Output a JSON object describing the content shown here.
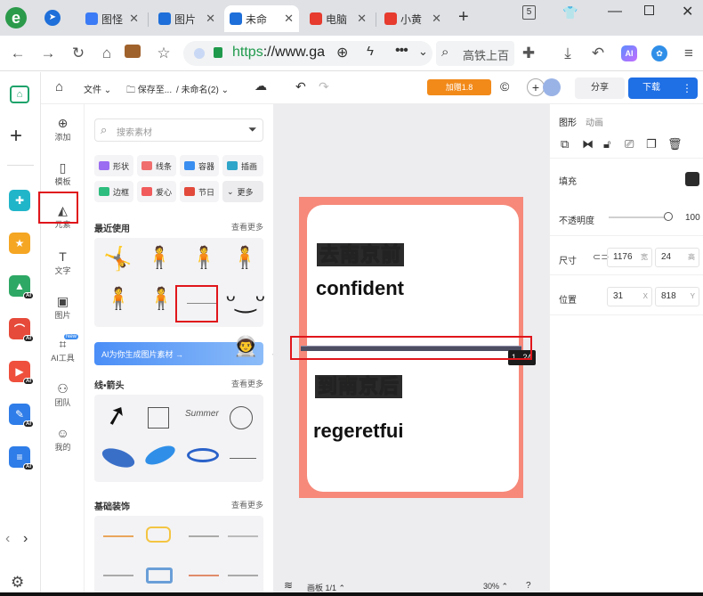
{
  "browser": {
    "tabs": [
      {
        "label": "图怪",
        "color": "#3b7bf5"
      },
      {
        "label": "图片",
        "color": "#1e6fd9"
      },
      {
        "label": "未命",
        "color": "#1e6fd9"
      },
      {
        "label": "电脑",
        "color": "#e63b2e"
      },
      {
        "label": "小黄",
        "color": "#e63b2e"
      }
    ],
    "new_tab": "+",
    "tab_count": "5",
    "url_https": "https",
    "url_rest": "://www.ga",
    "search_text": "高铁上百"
  },
  "editor": {
    "toolbar": {
      "file": "文件",
      "save": "保存至...",
      "doc_name": "未命名(2)",
      "promo": "加赠1.8",
      "share": "分享",
      "download": "下载"
    },
    "nav": [
      {
        "label": "添加",
        "icon": "plus-circle-icon"
      },
      {
        "label": "模板",
        "icon": "template-icon"
      },
      {
        "label": "元素",
        "icon": "element-icon"
      },
      {
        "label": "文字",
        "icon": "text-icon"
      },
      {
        "label": "图片",
        "icon": "image-icon"
      },
      {
        "label": "AI工具",
        "icon": "ai-tool-icon",
        "badge": "New"
      },
      {
        "label": "团队",
        "icon": "team-icon"
      },
      {
        "label": "我的",
        "icon": "user-icon"
      }
    ],
    "material": {
      "search_placeholder": "搜索素材",
      "chips": [
        {
          "label": "形状",
          "color": "#9b6df1"
        },
        {
          "label": "线条",
          "color": "#f06e6e"
        },
        {
          "label": "容器",
          "color": "#3a8ef0"
        },
        {
          "label": "插画",
          "color": "#2fa5c9"
        },
        {
          "label": "边框",
          "color": "#2dbd7e"
        },
        {
          "label": "爱心",
          "color": "#f15b5b"
        },
        {
          "label": "节日",
          "color": "#e24a3b"
        },
        {
          "label": "更多",
          "color": ""
        }
      ],
      "recent_title": "最近使用",
      "view_more": "查看更多",
      "ai_banner": "AI为你生成图片素材 →",
      "lines_title": "线•箭头",
      "lines_more": "查看更多",
      "deco_title": "基础装饰",
      "deco_more": "查看更多",
      "lines_text": "Summer"
    },
    "canvas": {
      "cn_top": "去南京前",
      "en_top": "confident",
      "cn_bottom": "到南京后",
      "en_bottom": "regeretfui",
      "size_tip_left": "1",
      "size_tip_right": "24",
      "page_label": "画板 1/1",
      "zoom": "30%",
      "help": "?"
    },
    "props": {
      "tab_shape": "图形",
      "tab_anim": "动画",
      "fill_label": "填充",
      "fill_color": "#2b2b2b",
      "opacity_label": "不透明度",
      "opacity_value": "100",
      "size_label": "尺寸",
      "width": "1176",
      "width_unit": "宽",
      "height": "24",
      "height_unit": "高",
      "pos_label": "位置",
      "x": "31",
      "x_unit": "X",
      "y": "818",
      "y_unit": "Y"
    }
  }
}
